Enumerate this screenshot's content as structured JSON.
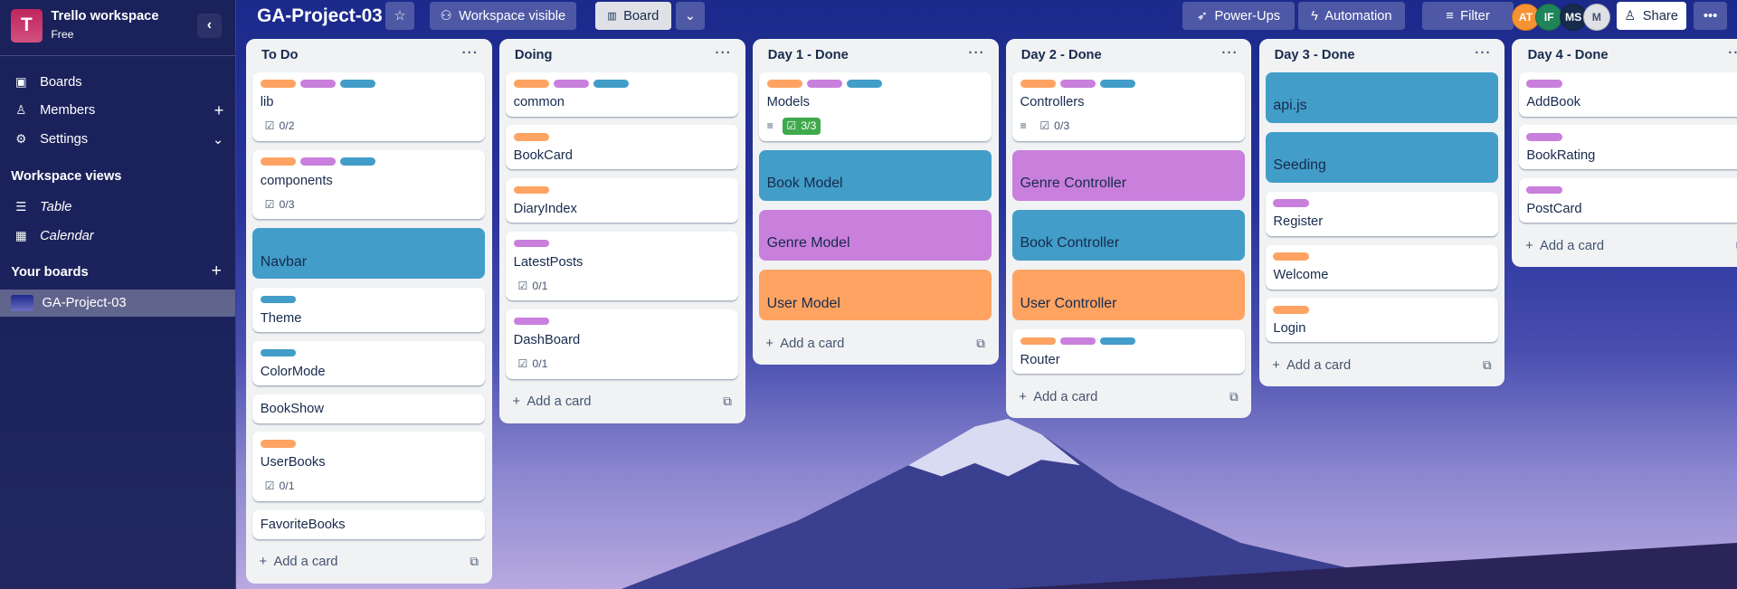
{
  "workspace": {
    "initial": "T",
    "name": "Trello workspace",
    "plan": "Free"
  },
  "sidebar": {
    "items": [
      {
        "label": "Boards",
        "icon": "board-icon"
      },
      {
        "label": "Members",
        "icon": "person-icon",
        "trailing": "+"
      },
      {
        "label": "Settings",
        "icon": "gear-icon",
        "trailing": "⌄"
      }
    ],
    "views_heading": "Workspace views",
    "views": [
      {
        "label": "Table",
        "icon": "table-icon"
      },
      {
        "label": "Calendar",
        "icon": "calendar-icon"
      }
    ],
    "boards_heading": "Your boards",
    "boards": [
      {
        "label": "GA-Project-03"
      }
    ]
  },
  "header": {
    "board_title": "GA-Project-03",
    "visibility": "Workspace visible",
    "view": "Board",
    "powerups": "Power-Ups",
    "automation": "Automation",
    "filter": "Filter",
    "share": "Share",
    "members": [
      {
        "initials": "AT",
        "color": "#f79232"
      },
      {
        "initials": "IF",
        "color": "#1f845a"
      },
      {
        "initials": "MS",
        "color": "#172b4d"
      },
      {
        "initials": "M",
        "color": "#dfe1e6"
      }
    ]
  },
  "label_colors": {
    "orange": "#fea362",
    "purple": "#c97fdc",
    "blue": "#429dc8"
  },
  "add_card_label": "Add a card",
  "lists": [
    {
      "title": "To Do",
      "cards": [
        {
          "labels": [
            "orange",
            "purple",
            "blue"
          ],
          "title": "lib",
          "checklist": "0/2"
        },
        {
          "labels": [
            "orange",
            "purple",
            "blue"
          ],
          "title": "components",
          "checklist": "0/3"
        },
        {
          "cover": "blue",
          "title": "Navbar"
        },
        {
          "labels": [
            "blue"
          ],
          "title": "Theme"
        },
        {
          "labels": [
            "blue"
          ],
          "title": "ColorMode"
        },
        {
          "title": "BookShow"
        },
        {
          "labels": [
            "orange"
          ],
          "title": "UserBooks",
          "checklist": "0/1"
        },
        {
          "title": "FavoriteBooks"
        }
      ]
    },
    {
      "title": "Doing",
      "cards": [
        {
          "labels": [
            "orange",
            "purple",
            "blue"
          ],
          "title": "common"
        },
        {
          "labels": [
            "orange"
          ],
          "title": "BookCard"
        },
        {
          "labels": [
            "orange"
          ],
          "title": "DiaryIndex"
        },
        {
          "labels": [
            "purple"
          ],
          "title": "LatestPosts",
          "checklist": "0/1"
        },
        {
          "labels": [
            "purple"
          ],
          "title": "DashBoard",
          "checklist": "0/1"
        }
      ]
    },
    {
      "title": "Day 1 - Done",
      "cards": [
        {
          "labels": [
            "orange",
            "purple",
            "blue"
          ],
          "title": "Models",
          "description": true,
          "checklist": "3/3",
          "complete": true
        },
        {
          "cover": "blue",
          "title": "Book Model"
        },
        {
          "cover": "purple",
          "title": "Genre Model"
        },
        {
          "cover": "orange",
          "title": "User Model"
        }
      ]
    },
    {
      "title": "Day 2 - Done",
      "cards": [
        {
          "labels": [
            "orange",
            "purple",
            "blue"
          ],
          "title": "Controllers",
          "description": true,
          "checklist": "0/3"
        },
        {
          "cover": "purple",
          "title": "Genre Controller"
        },
        {
          "cover": "blue",
          "title": "Book Controller"
        },
        {
          "cover": "orange",
          "title": "User Controller"
        },
        {
          "labels": [
            "orange",
            "purple",
            "blue"
          ],
          "title": "Router"
        }
      ]
    },
    {
      "title": "Day 3 - Done",
      "cards": [
        {
          "cover": "blue",
          "title": "api.js"
        },
        {
          "cover": "blue",
          "title": "Seeding"
        },
        {
          "labels": [
            "purple"
          ],
          "title": "Register"
        },
        {
          "labels": [
            "orange"
          ],
          "title": "Welcome"
        },
        {
          "labels": [
            "orange"
          ],
          "title": "Login"
        }
      ]
    },
    {
      "title": "Day 4 - Done",
      "cards": [
        {
          "labels": [
            "purple"
          ],
          "title": "AddBook"
        },
        {
          "labels": [
            "purple"
          ],
          "title": "BookRating"
        },
        {
          "labels": [
            "purple"
          ],
          "title": "PostCard"
        }
      ]
    }
  ]
}
